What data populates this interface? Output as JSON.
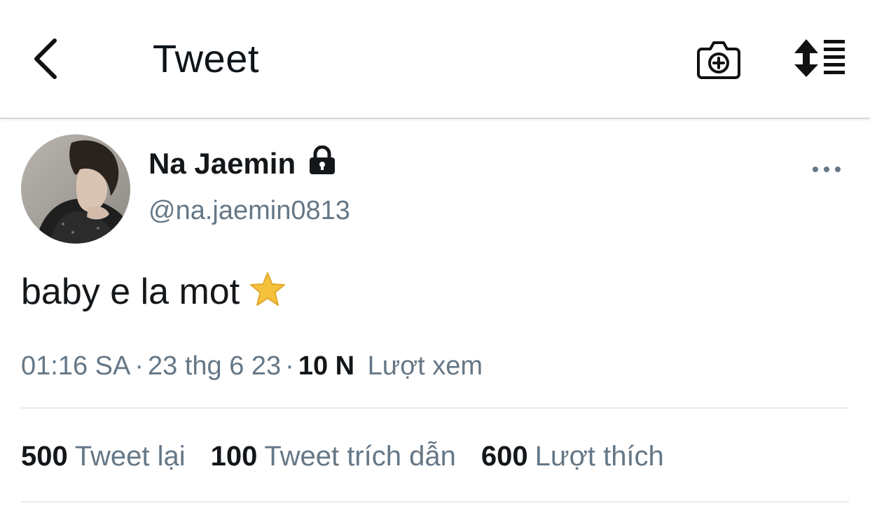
{
  "header": {
    "title": "Tweet",
    "back_icon": "chevron-left-icon",
    "camera_icon": "camera-plus-icon",
    "sort_icon": "sort-list-icon"
  },
  "tweet": {
    "author": {
      "name": "Na Jaemin",
      "handle": "@na.jaemin0813",
      "locked": true,
      "lock_icon": "lock-icon"
    },
    "more_icon": "ellipsis-icon",
    "text": "baby e la mot",
    "emoji": "star-icon",
    "time": "01:16 SA",
    "date": "23 thg 6 23",
    "views_count": "10 N",
    "views_label": "Lượt xem",
    "stats": [
      {
        "count": "500",
        "label": "Tweet lại"
      },
      {
        "count": "100",
        "label": "Tweet trích dẫn"
      },
      {
        "count": "600",
        "label": "Lượt thích"
      }
    ]
  },
  "colors": {
    "text_primary": "#14171a",
    "text_secondary": "#657786",
    "divider": "#e6ecf0",
    "star": "#f6c23e"
  }
}
